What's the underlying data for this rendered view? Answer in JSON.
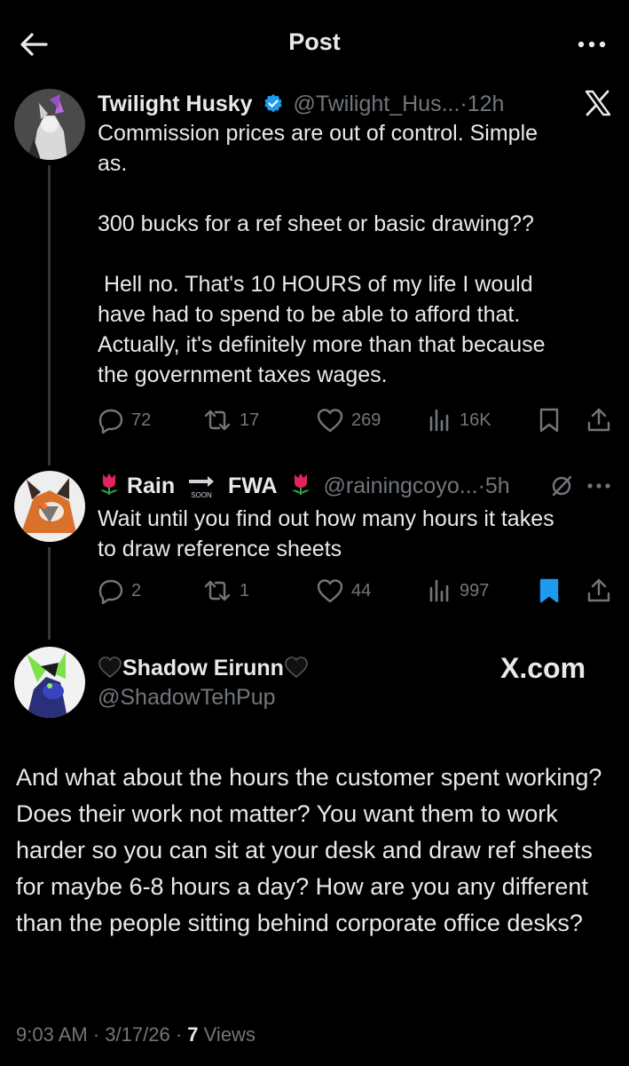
{
  "header": {
    "title": "Post"
  },
  "tweet1": {
    "display_name": "Twilight Husky",
    "handle": "@Twilight_Hus...",
    "sep": "·",
    "time": "12h",
    "text": "Commission prices are out of control. Simple\nas.\n\n300 bucks for a ref sheet or basic drawing??\n\n Hell no. That's 10 HOURS of my life I would\nhave had to spend to be able to afford that.\nActually, it's definitely more than that because\nthe government taxes wages.",
    "replies": "72",
    "reposts": "17",
    "likes": "269",
    "views": "16K"
  },
  "tweet2": {
    "name_a": "Rain",
    "soon": "SOON",
    "name_b": "FWA",
    "handle": "@rainingcoyo...",
    "sep": "·",
    "time": "5h",
    "text": "Wait until you find out how many hours it takes\nto draw reference sheets",
    "replies": "2",
    "reposts": "1",
    "likes": "44",
    "views": "997",
    "bookmarked": true
  },
  "main": {
    "display_name": "Shadow Eirunn",
    "handle": "@ShadowTehPup",
    "watermark": "X.com",
    "text": "And what about the hours the customer spent working? Does their work not matter? You want them to work harder so you can sit at your desk and draw ref sheets for maybe 6-8 hours a day? How are you any different than the people sitting behind corporate office desks?",
    "time": "9:03 AM",
    "sep1": "·",
    "date": "3/17/26",
    "sep2": "·",
    "views_count": "7",
    "views_label": "Views"
  },
  "colors": {
    "background": "#000000",
    "text": "#e7e9ea",
    "muted": "#71767b",
    "verified": "#1d9bf0",
    "bookmark_active": "#1d9bf0",
    "tulip": "#e0245e"
  }
}
